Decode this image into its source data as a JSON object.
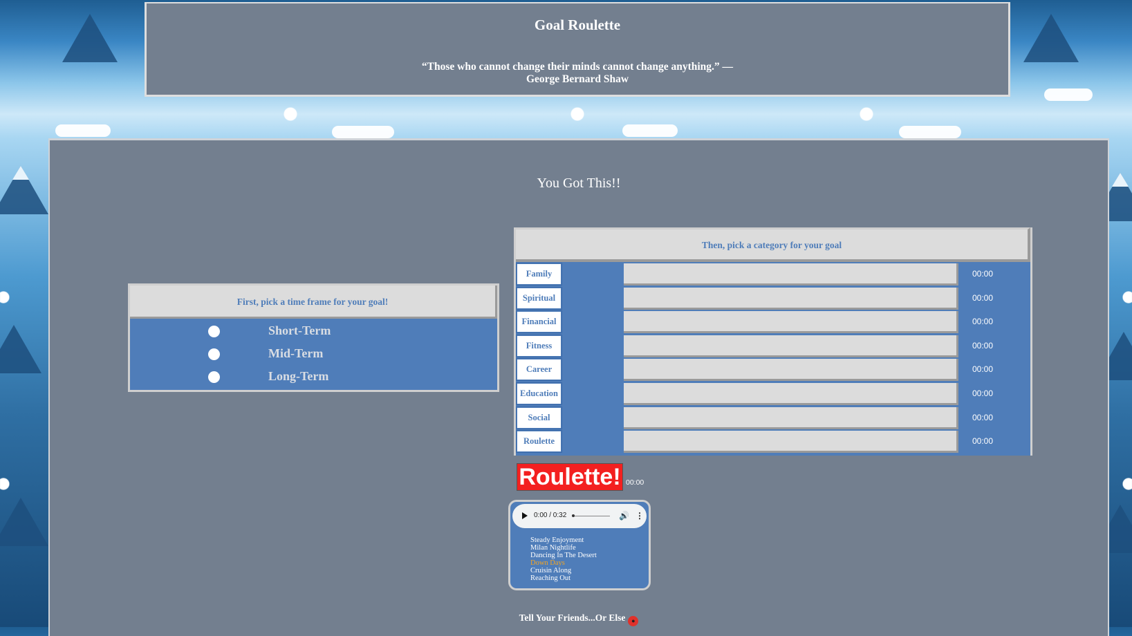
{
  "header": {
    "title": "Goal Roulette",
    "quote_line1": "“Those who cannot change their minds cannot change anything.” —",
    "quote_line2": "George Bernard Shaw"
  },
  "main": {
    "tagline": "You Got This!!"
  },
  "timeframe": {
    "heading": "First, pick a time frame for your goal!",
    "options": [
      "Short-Term",
      "Mid-Term",
      "Long-Term"
    ]
  },
  "categories": {
    "heading": "Then, pick a category for your goal",
    "items": [
      {
        "label": "Family",
        "time": "00:00"
      },
      {
        "label": "Spiritual",
        "time": "00:00"
      },
      {
        "label": "Financial",
        "time": "00:00"
      },
      {
        "label": "Fitness",
        "time": "00:00"
      },
      {
        "label": "Career",
        "time": "00:00"
      },
      {
        "label": "Education",
        "time": "00:00"
      },
      {
        "label": "Social",
        "time": "00:00"
      },
      {
        "label": "Roulette",
        "time": "00:00"
      }
    ]
  },
  "roulette": {
    "button_label": "Roulette!",
    "time": "00:00"
  },
  "player": {
    "time_display": "0:00 / 0:32",
    "tracks": [
      {
        "title": "Steady Enjoyment",
        "active": false
      },
      {
        "title": "Milan Nightlife",
        "active": false
      },
      {
        "title": "Dancing In The Desert",
        "active": false
      },
      {
        "title": "Down Days",
        "active": true
      },
      {
        "title": "Cruisin Along",
        "active": false
      },
      {
        "title": "Reaching Out",
        "active": false
      }
    ]
  },
  "footer": {
    "text": "Tell Your Friends...Or Else"
  },
  "colors": {
    "panel_blue": "#4f7db9",
    "panel_gray": "#737f8f",
    "roulette_red": "#f32020",
    "active_track": "#f5a623"
  }
}
